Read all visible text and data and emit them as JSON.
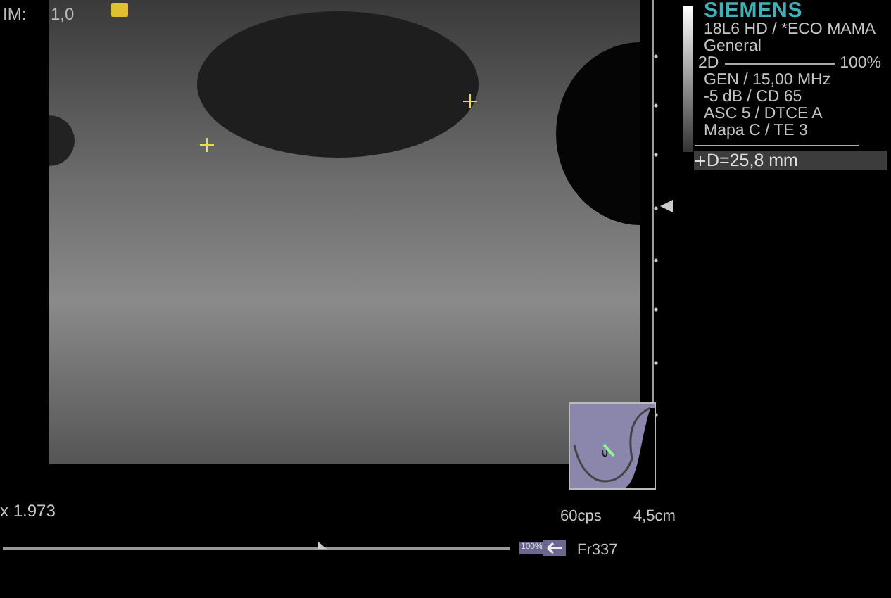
{
  "header": {
    "im_label": "IM:",
    "im_value": "1,0"
  },
  "info_panel": {
    "brand": "SIEMENS",
    "lines": [
      "18L6 HD / *ECO MAMA",
      "General"
    ],
    "mode": "2D",
    "mode_value": "100%",
    "params": [
      "GEN / 15,00 MHz",
      "-5 dB / CD 65",
      "ASC 5 / DTCE A",
      "Mapa C / TE 3"
    ],
    "measurement": "D=25,8 mm"
  },
  "bottom": {
    "zoom": "x 1.973",
    "frame_rate": "60cps",
    "depth": "4,5cm",
    "cine": {
      "level": 0.63,
      "badge": "100%",
      "frame": "Fr337"
    }
  }
}
